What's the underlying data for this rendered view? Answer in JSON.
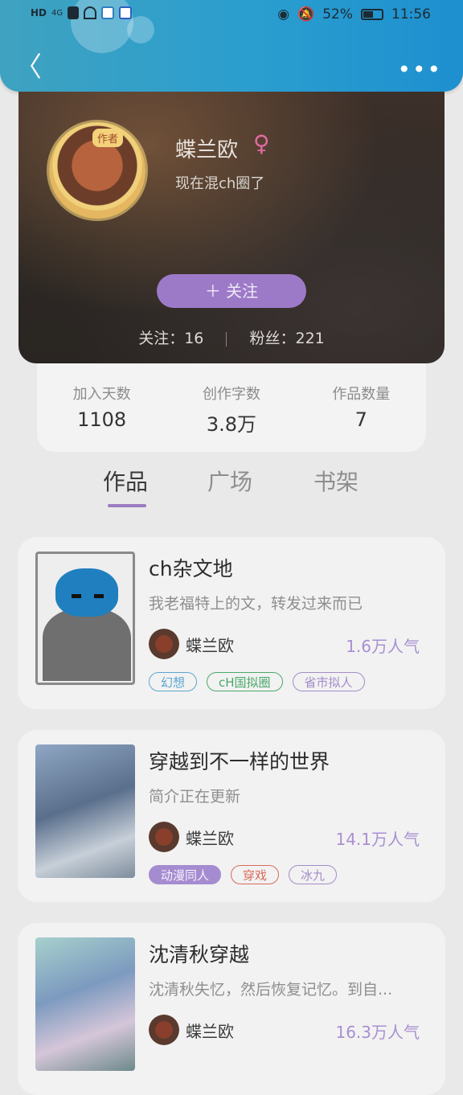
{
  "status_bar": {
    "left_labels": [
      "HD",
      "4G"
    ],
    "battery": "52%",
    "time": "11:56"
  },
  "nav": {
    "back_label": "〈",
    "more_label": "•••"
  },
  "profile": {
    "name": "蝶兰欧",
    "gender_symbol": "♀",
    "badge": "作者",
    "bio": "现在混ch圈了",
    "follow_button": "＋ 关注",
    "following_label": "关注：16",
    "fans_label": "粉丝：221"
  },
  "stats": [
    {
      "label": "加入天数",
      "value": "1108"
    },
    {
      "label": "创作字数",
      "value": "3.8万"
    },
    {
      "label": "作品数量",
      "value": "7"
    }
  ],
  "tabs": [
    {
      "label": "作品",
      "active": true
    },
    {
      "label": "广场",
      "active": false
    },
    {
      "label": "书架",
      "active": false
    }
  ],
  "works": [
    {
      "title": "ch杂文地",
      "desc": "我老福特上的文，转发过来而已",
      "author": "蝶兰欧",
      "popularity": "1.6万人气",
      "tags": [
        "幻想",
        "cH国拟圈",
        "省市拟人"
      ]
    },
    {
      "title": "穿越到不一样的世界",
      "desc": "简介正在更新",
      "author": "蝶兰欧",
      "popularity": "14.1万人气",
      "tags": [
        "动漫同人",
        "穿戏",
        "冰九"
      ]
    },
    {
      "title": "沈清秋穿越",
      "desc": "沈清秋失忆，然后恢复记忆。到自...",
      "author": "蝶兰欧",
      "popularity": "16.3万人气",
      "tags": []
    }
  ],
  "colors": {
    "accent_purple": "#9d7ac8",
    "header_blue": "#2a9ecf"
  }
}
